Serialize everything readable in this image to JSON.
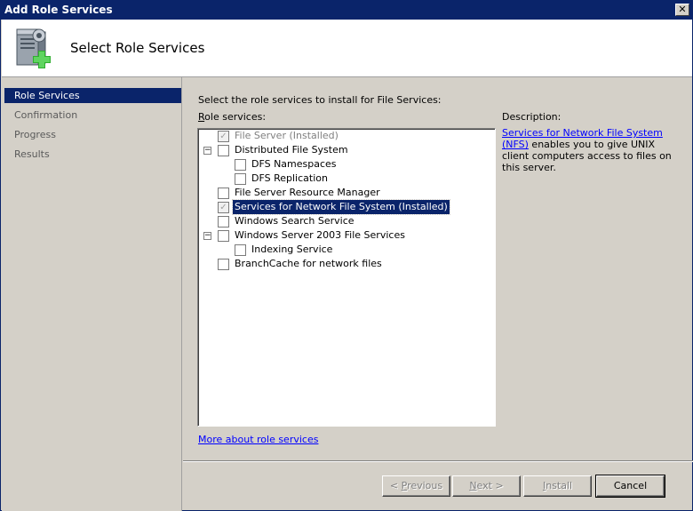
{
  "window": {
    "title": "Add Role Services",
    "close_glyph": "✕"
  },
  "header": {
    "title": "Select Role Services",
    "icon": "server-add-icon"
  },
  "nav": {
    "items": [
      {
        "label": "Role Services",
        "active": true
      },
      {
        "label": "Confirmation",
        "active": false
      },
      {
        "label": "Progress",
        "active": false
      },
      {
        "label": "Results",
        "active": false
      }
    ]
  },
  "main": {
    "instruction": "Select the role services to install for File Services:",
    "role_services_label_prefix": "R",
    "role_services_label_rest": "ole services:",
    "description_label": "Description:",
    "description_link": "Services for Network File System (NFS)",
    "description_text": " enables you to give UNIX client computers access to files on this server.",
    "more_link": "More about role services"
  },
  "tree": {
    "items": [
      {
        "label": "File Server  (Installed)",
        "checked": true,
        "disabled": true
      },
      {
        "label": "Distributed File System",
        "checked": false,
        "expander": "−"
      },
      {
        "label": "DFS Namespaces",
        "checked": false
      },
      {
        "label": "DFS Replication",
        "checked": false
      },
      {
        "label": "File Server Resource Manager",
        "checked": false
      },
      {
        "label": "Services for Network File System  (Installed)",
        "checked": true,
        "selected": true
      },
      {
        "label": "Windows Search Service",
        "checked": false
      },
      {
        "label": "Windows Server 2003 File Services",
        "checked": false,
        "expander": "−"
      },
      {
        "label": "Indexing Service",
        "checked": false
      },
      {
        "label": "BranchCache for network files",
        "checked": false
      }
    ]
  },
  "buttons": {
    "previous_pre": "< ",
    "previous_key": "P",
    "previous_rest": "revious",
    "next_key": "N",
    "next_rest": "ext >",
    "install_key": "I",
    "install_rest": "nstall",
    "cancel": "Cancel"
  },
  "colors": {
    "title_bar": "#0a246a",
    "selection": "#0a246a",
    "link": "#0000ff",
    "face": "#d4d0c8"
  }
}
